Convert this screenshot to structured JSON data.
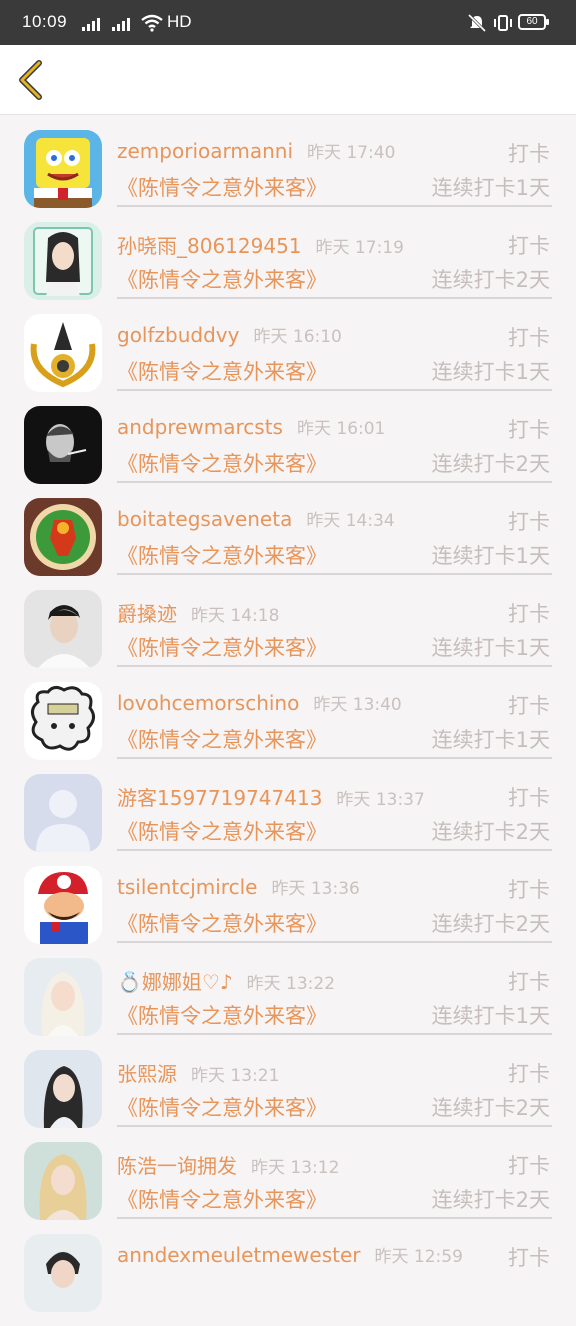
{
  "status": {
    "time": "10:09",
    "network": "HD",
    "battery": "60"
  },
  "header": {
    "back_icon": "chevron-left-icon",
    "accent": "#e3b423"
  },
  "colors": {
    "name": "#e8955a",
    "muted": "#c6bebc"
  },
  "items": [
    {
      "name": "zemporioarmanni",
      "time": "昨天 17:40",
      "action": "打卡",
      "book": "《陈情令之意外来客》",
      "streak": "连续打卡1天"
    },
    {
      "name": "孙晓雨_806129451",
      "time": "昨天 17:19",
      "action": "打卡",
      "book": "《陈情令之意外来客》",
      "streak": "连续打卡2天"
    },
    {
      "name": "golfzbuddvy",
      "time": "昨天 16:10",
      "action": "打卡",
      "book": "《陈情令之意外来客》",
      "streak": "连续打卡1天"
    },
    {
      "name": "andprewmarcsts",
      "time": "昨天 16:01",
      "action": "打卡",
      "book": "《陈情令之意外来客》",
      "streak": "连续打卡2天"
    },
    {
      "name": "boitategsaveneta",
      "time": "昨天 14:34",
      "action": "打卡",
      "book": "《陈情令之意外来客》",
      "streak": "连续打卡1天"
    },
    {
      "name": "爵搡迹",
      "time": "昨天 14:18",
      "action": "打卡",
      "book": "《陈情令之意外来客》",
      "streak": "连续打卡1天"
    },
    {
      "name": "lovohcemorschino",
      "time": "昨天 13:40",
      "action": "打卡",
      "book": "《陈情令之意外来客》",
      "streak": "连续打卡1天"
    },
    {
      "name": "游客1597719747413",
      "time": "昨天 13:37",
      "action": "打卡",
      "book": "《陈情令之意外来客》",
      "streak": "连续打卡2天"
    },
    {
      "name": "tsilentcjmircle",
      "time": "昨天 13:36",
      "action": "打卡",
      "book": "《陈情令之意外来客》",
      "streak": "连续打卡2天"
    },
    {
      "name": "💍娜娜姐♡♪",
      "time": "昨天 13:22",
      "action": "打卡",
      "book": "《陈情令之意外来客》",
      "streak": "连续打卡1天"
    },
    {
      "name": "张熙源",
      "time": "昨天 13:21",
      "action": "打卡",
      "book": "《陈情令之意外来客》",
      "streak": "连续打卡2天"
    },
    {
      "name": "陈浩一询拥发",
      "time": "昨天 13:12",
      "action": "打卡",
      "book": "《陈情令之意外来客》",
      "streak": "连续打卡2天"
    },
    {
      "name": "anndexmeuletmewester",
      "time": "昨天 12:59",
      "action": "打卡",
      "book": "",
      "streak": ""
    }
  ]
}
